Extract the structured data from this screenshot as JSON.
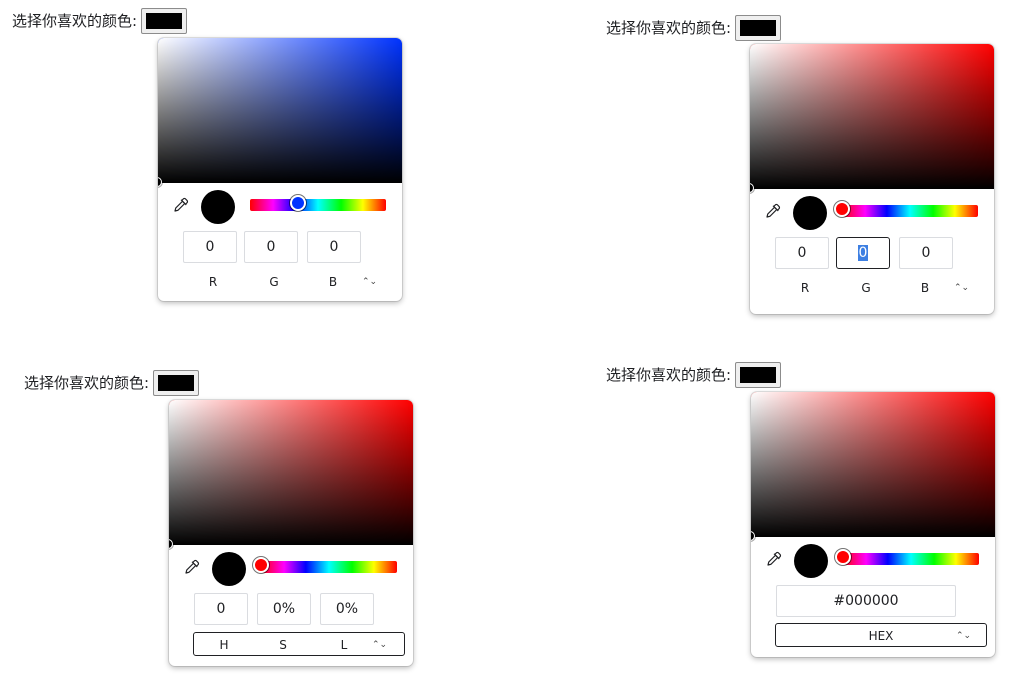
{
  "label": "选择你喜欢的颜色:",
  "selected_color": "#000000",
  "pickers": [
    {
      "id": "rgb-blue",
      "format": "RGB",
      "hue_color": "#0033ff",
      "hue_position": 0.35,
      "values": [
        "0",
        "0",
        "0"
      ],
      "channel_labels": [
        "R",
        "G",
        "B"
      ],
      "toggle_icon": "⌃⌄"
    },
    {
      "id": "rgb-red",
      "format": "RGB",
      "hue_color": "#ff0000",
      "hue_position": 0.0,
      "values": [
        "0",
        "0",
        "0"
      ],
      "focused_index": 1,
      "channel_labels": [
        "R",
        "G",
        "B"
      ],
      "toggle_icon": "⌃⌄"
    },
    {
      "id": "hsl",
      "format": "HSL",
      "hue_color": "#ff0000",
      "hue_position": 0.0,
      "values": [
        "0",
        "0%",
        "0%"
      ],
      "channel_labels": [
        "H",
        "S",
        "L"
      ],
      "toggle_icon": "⌃⌄"
    },
    {
      "id": "hex",
      "format": "HEX",
      "hue_color": "#ff0000",
      "hue_position": 0.0,
      "hex_value": "#000000",
      "format_label": "HEX",
      "toggle_icon": "⌃⌄"
    }
  ],
  "icons": {
    "eyedropper": "eyedropper-icon",
    "toggle": "chevron-up-down-icon"
  }
}
